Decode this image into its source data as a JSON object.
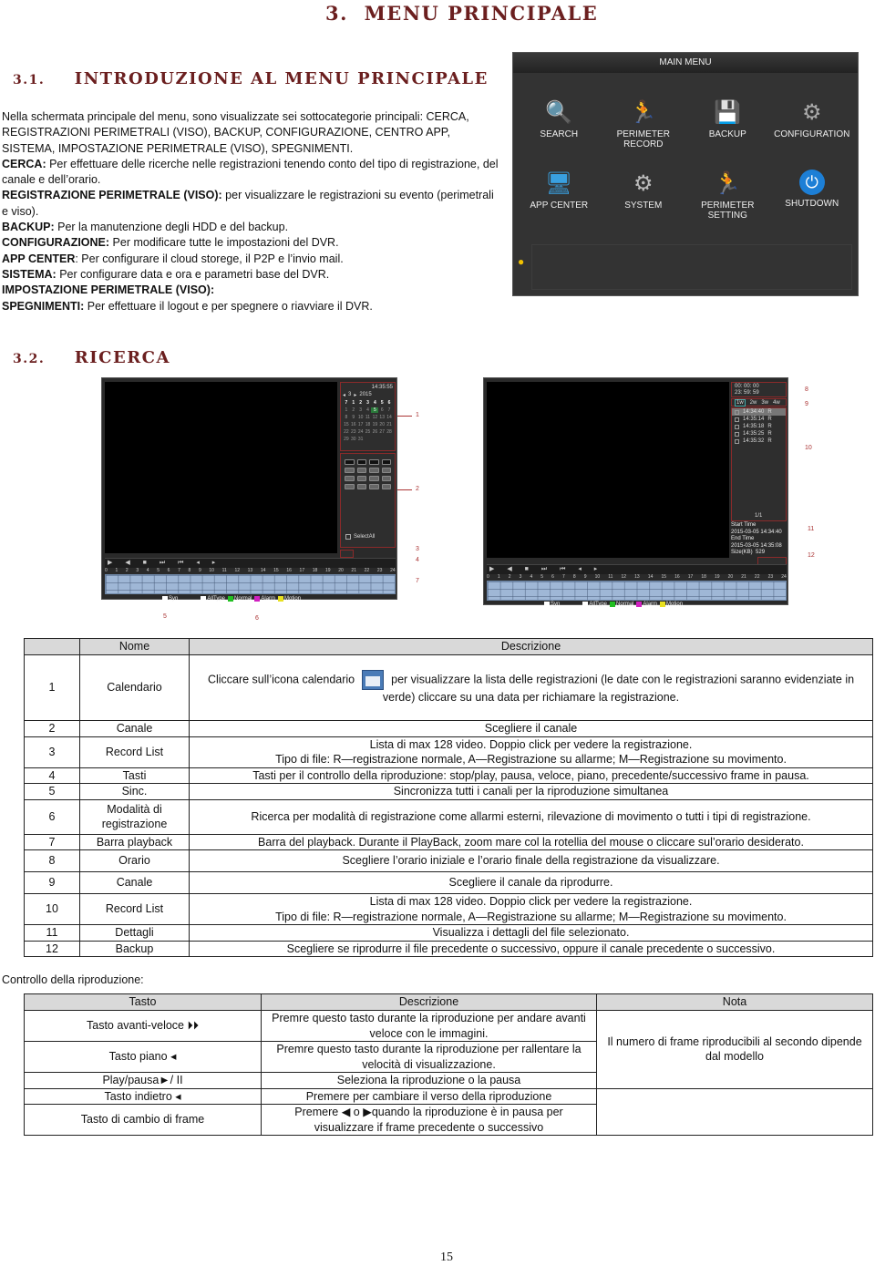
{
  "heading": {
    "number": "3.",
    "title": "MENU PRINCIPALE"
  },
  "section_1": {
    "number": "3.1.",
    "title": "INTRODUZIONE AL MENU PRINCIPALE",
    "intro": "Nella schermata principale del menu, sono visualizzate sei sottocategorie principali: CERCA, REGISTRAZIONI PERIMETRALI (VISO), BACKUP, CONFIGURAZIONE, CENTRO APP, SISTEMA, IMPOSTAZIONE PERIMETRALE (VISO), SPEGNIMENTI.",
    "items": [
      {
        "term": "CERCA:",
        "desc": " Per effettuare delle ricerche nelle registrazioni tenendo conto del tipo di registrazione, del canale e dell’orario."
      },
      {
        "term": "REGISTRAZIONE PERIMETRALE (VISO):",
        "desc": " per visualizzare le registrazioni su evento (perimetrali e viso)."
      },
      {
        "term": "BACKUP:",
        "desc": " Per la manutenzione degli HDD e del backup."
      },
      {
        "term": "CONFIGURAZIONE:",
        "desc": " Per modificare tutte le impostazioni del DVR."
      },
      {
        "term": "APP CENTER",
        "desc": ": Per configurare il cloud storege, il P2P e l’invio mail."
      },
      {
        "term": "SISTEMA:",
        "desc": " Per configurare data e ora e parametri base del DVR."
      },
      {
        "term": "IMPOSTAZIONE PERIMETRALE (VISO):",
        "desc": ""
      },
      {
        "term": "SPEGNIMENTI:",
        "desc": " Per effettuare il logout e per spegnere o riavviare il DVR."
      }
    ]
  },
  "main_menu": {
    "title": "MAIN MENU",
    "items": [
      {
        "label": "SEARCH",
        "icon": "search-video-icon"
      },
      {
        "label": "PERIMETER RECORD",
        "icon": "perimeter-record-icon"
      },
      {
        "label": "BACKUP",
        "icon": "backup-icon"
      },
      {
        "label": "CONFIGURATION",
        "icon": "configuration-icon"
      },
      {
        "label": "APP CENTER",
        "icon": "app-center-icon"
      },
      {
        "label": "SYSTEM",
        "icon": "system-gears-icon"
      },
      {
        "label": "PERIMETER SETTING",
        "icon": "perimeter-setting-icon"
      },
      {
        "label": "SHUTDOWN",
        "icon": "power-icon"
      }
    ]
  },
  "section_2": {
    "number": "3.2.",
    "title": "RICERCA"
  },
  "playback_left": {
    "clock": "14:35:55",
    "month": "3",
    "year": "2015",
    "weekdays": [
      "7",
      "1",
      "2",
      "3",
      "4",
      "5",
      "6"
    ],
    "days": [
      "1",
      "2",
      "3",
      "4",
      "5",
      "6",
      "7",
      "8",
      "9",
      "10",
      "11",
      "12",
      "13",
      "14",
      "15",
      "16",
      "17",
      "18",
      "19",
      "20",
      "21",
      "22",
      "23",
      "24",
      "25",
      "26",
      "27",
      "28",
      "29",
      "30",
      "31"
    ],
    "highlighted_day": "5",
    "select_all": "SelectAll",
    "callouts": [
      "1",
      "2",
      "3",
      "4",
      "7",
      "5",
      "6"
    ]
  },
  "playback_right": {
    "start_time": "00: 00: 00",
    "end_time": "23: 59: 59",
    "channel_tabs": [
      "1w",
      "2w",
      "3w",
      "4w"
    ],
    "records": [
      {
        "time": "14:34:40",
        "type": "R"
      },
      {
        "time": "14:35:14",
        "type": "R"
      },
      {
        "time": "14:35:18",
        "type": "R"
      },
      {
        "time": "14:35:25",
        "type": "R"
      },
      {
        "time": "14:35:32",
        "type": "R"
      }
    ],
    "page": "1/1",
    "details": {
      "start_label": "Start Time",
      "start_value": "2015-03-05 14:34:40",
      "end_label": "End Time",
      "end_value": "2015-03-05 14:35:08",
      "size_label": "Size(KB)",
      "size_value": "529"
    },
    "callouts": [
      "8",
      "9",
      "10",
      "11",
      "12"
    ]
  },
  "playback_common": {
    "hours": [
      "0",
      "1",
      "2",
      "3",
      "4",
      "5",
      "6",
      "7",
      "8",
      "9",
      "10",
      "11",
      "12",
      "13",
      "14",
      "15",
      "16",
      "17",
      "18",
      "19",
      "20",
      "21",
      "22",
      "23",
      "24"
    ],
    "syn": "Syn",
    "alltype": "AllType",
    "normal": "Normal",
    "alarm": "Alarm",
    "motion": "Motion",
    "colors": {
      "normal": "#22c022",
      "alarm": "#d020c0",
      "motion": "#e8e020",
      "frame": "#8b2a2a"
    }
  },
  "table_1": {
    "headers": [
      "",
      "Nome",
      "Descrizione"
    ],
    "rows": [
      {
        "n": "1",
        "name": "Calendario",
        "desc_a": "Cliccare sull’icona calendario",
        "desc_b": "per visualizzare la lista delle registrazioni (le date con le registrazioni saranno evidenziate in verde) cliccare su una data per richiamare la registrazione."
      },
      {
        "n": "2",
        "name": "Canale",
        "desc": "Scegliere il canale"
      },
      {
        "n": "3",
        "name": "Record List",
        "desc": "Lista di max 128 video. Doppio click per vedere la registrazione.",
        "desc2": "Tipo di file: R—registrazione normale, A—Registrazione su allarme; M—Registrazione su movimento."
      },
      {
        "n": "4",
        "name": "Tasti",
        "desc": "Tasti per il controllo della riproduzione: stop/play, pausa, veloce, piano, precedente/successivo frame in pausa."
      },
      {
        "n": "5",
        "name": "Sinc.",
        "desc": "Sincronizza tutti i canali per la riproduzione simultanea"
      },
      {
        "n": "6",
        "name": "Modalità di registrazione",
        "desc": "Ricerca per modalità di registrazione come allarmi esterni, rilevazione di movimento o tutti i tipi di registrazione."
      },
      {
        "n": "7",
        "name": "Barra playback",
        "desc": "Barra del playback. Durante il PlayBack, zoom mare col la rotellia del mouse o cliccare sul’orario desiderato."
      },
      {
        "n": "8",
        "name": "Orario",
        "desc": "Scegliere l’orario iniziale e l’orario finale della registrazione da visualizzare."
      },
      {
        "n": "9",
        "name": "Canale",
        "desc": "Scegliere il canale da riprodurre."
      },
      {
        "n": "10",
        "name": "Record List",
        "desc": "Lista di max 128 video. Doppio click per vedere la registrazione.",
        "desc2": "Tipo di file: R—registrazione normale, A—Registrazione su allarme; M—Registrazione su movimento."
      },
      {
        "n": "11",
        "name": "Dettagli",
        "desc": "Visualizza i dettagli del file selezionato."
      },
      {
        "n": "12",
        "name": "Backup",
        "desc": "Scegliere se riprodurre il file precedente o successivo, oppure il canale precedente o successivo."
      }
    ]
  },
  "controls_label": "Controllo della riproduzione:",
  "table_2": {
    "headers": [
      "Tasto",
      "Descrizione",
      "Nota"
    ],
    "rows": [
      {
        "key": "Tasto avanti-veloce ⏵⏵",
        "desc": "Premre questo tasto durante la riproduzione per andare avanti veloce con le immagini."
      },
      {
        "key": "Tasto piano ◂",
        "desc": "Premre questo tasto durante la riproduzione per rallentare la velocità di visualizzazione."
      },
      {
        "key": "Play/pausa►/ II",
        "desc": "Seleziona la riproduzione o la pausa"
      },
      {
        "key": "Tasto indietro ◂",
        "desc": "Premere per cambiare il verso della riproduzione"
      },
      {
        "key": "Tasto di cambio di frame",
        "desc": "Premere ◀ o ▶quando la riproduzione è in pausa per visualizzare if frame precedente o successivo"
      }
    ],
    "note_1": "Il numero di frame riproducibili al secondo dipende dal modello",
    "note_2": ""
  },
  "page_number": "15"
}
